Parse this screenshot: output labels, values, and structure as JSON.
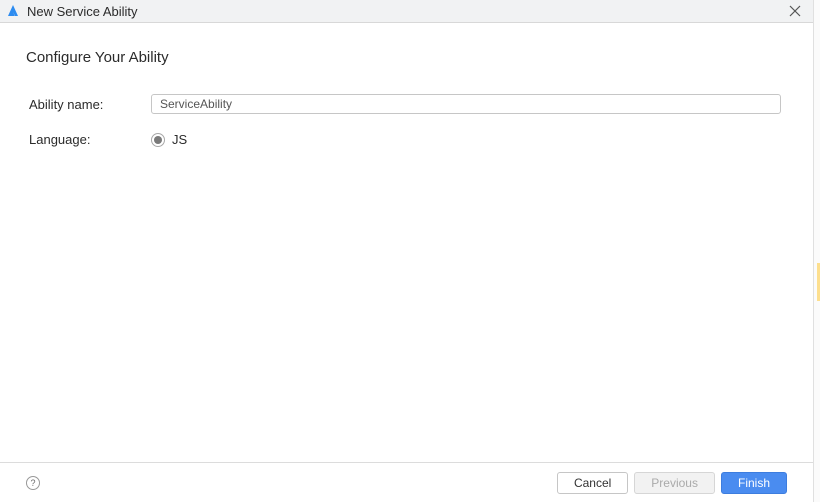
{
  "titlebar": {
    "title": "New Service Ability"
  },
  "page": {
    "heading": "Configure Your Ability"
  },
  "form": {
    "abilityName": {
      "label": "Ability name:",
      "value": "ServiceAbility"
    },
    "language": {
      "label": "Language:",
      "options": [
        {
          "label": "JS",
          "selected": true
        }
      ]
    }
  },
  "footer": {
    "help": "?",
    "cancel": "Cancel",
    "previous": "Previous",
    "finish": "Finish"
  }
}
